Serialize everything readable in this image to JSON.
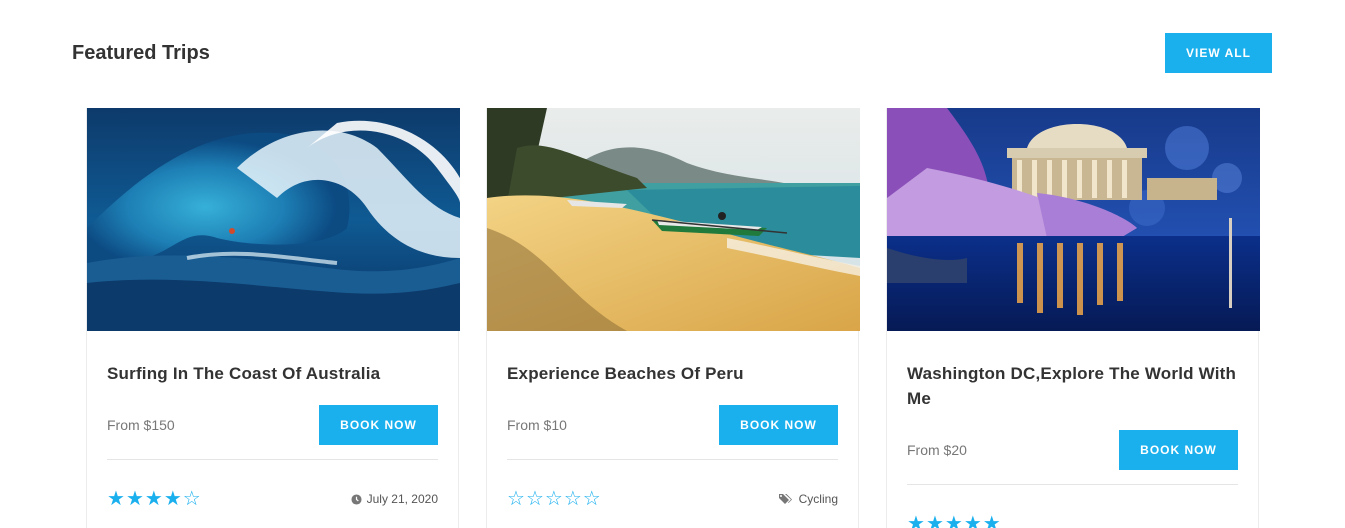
{
  "section": {
    "title": "Featured Trips",
    "view_all_label": "VIEW ALL"
  },
  "accent_color": "#1ab0ee",
  "cards": [
    {
      "title": "Surfing In The Coast Of Australia",
      "price": "From $150",
      "book_label": "BOOK NOW",
      "rating": 4,
      "max_rating": 5,
      "meta_icon": "clock-icon",
      "meta_text": "July 21, 2020",
      "image": "ocean-wave-surfer"
    },
    {
      "title": "Experience Beaches Of Peru",
      "price": "From $10",
      "book_label": "BOOK NOW",
      "rating": 0,
      "max_rating": 5,
      "meta_icon": "tags-icon",
      "meta_text": "Cycling",
      "image": "tropical-beach-boats"
    },
    {
      "title": "Washington DC,Explore The World With Me",
      "price": "From $20",
      "book_label": "BOOK NOW",
      "rating": 5,
      "max_rating": 5,
      "meta_icon": "",
      "meta_text": "",
      "image": "jefferson-memorial-night"
    }
  ]
}
